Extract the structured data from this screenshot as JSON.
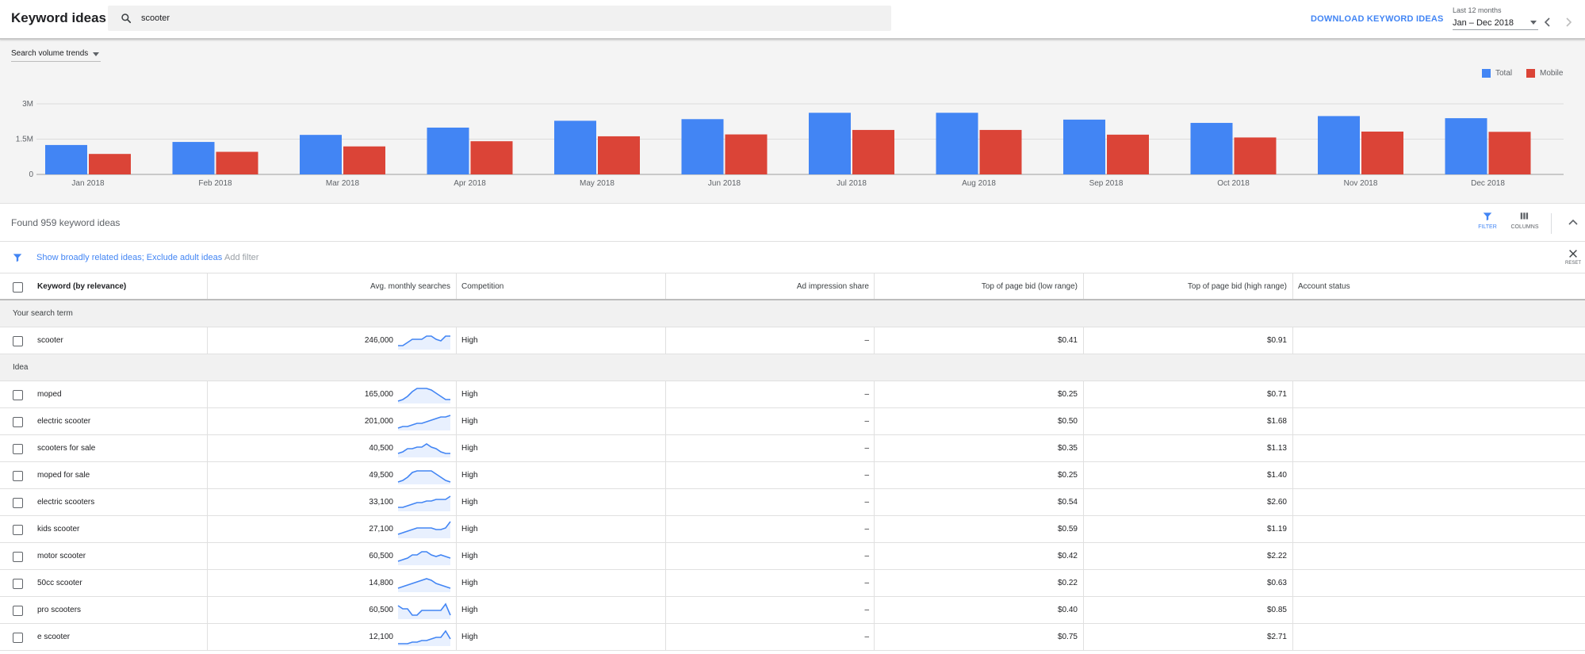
{
  "header": {
    "title": "Keyword ideas",
    "search_value": "scooter",
    "download_label": "DOWNLOAD KEYWORD IDEAS",
    "range_label": "Last 12 months",
    "range_value": "Jan – Dec 2018"
  },
  "chart_panel": {
    "trend_select": "Search volume trends",
    "legend": [
      {
        "name": "Total",
        "color": "#4285f4"
      },
      {
        "name": "Mobile",
        "color": "#db4437"
      }
    ]
  },
  "chart_data": {
    "type": "bar",
    "title": "",
    "categories": [
      "Jan 2018",
      "Feb 2018",
      "Mar 2018",
      "Apr 2018",
      "May 2018",
      "Jun 2018",
      "Jul 2018",
      "Aug 2018",
      "Sep 2018",
      "Oct 2018",
      "Nov 2018",
      "Dec 2018"
    ],
    "series": [
      {
        "name": "Total",
        "color": "#4285f4",
        "values": [
          1250000,
          1380000,
          1680000,
          1990000,
          2280000,
          2350000,
          2620000,
          2620000,
          2330000,
          2190000,
          2480000,
          2390000
        ]
      },
      {
        "name": "Mobile",
        "color": "#db4437",
        "values": [
          870000,
          960000,
          1190000,
          1410000,
          1620000,
          1700000,
          1890000,
          1890000,
          1690000,
          1570000,
          1820000,
          1810000
        ]
      }
    ],
    "yticks": [
      "0",
      "1.5M",
      "3M"
    ],
    "ylim": [
      0,
      3000000
    ],
    "grid": true,
    "legend_position": "top-right"
  },
  "summary": {
    "found_text": "Found 959 keyword ideas",
    "filter_label": "FILTER",
    "columns_label": "COLUMNS"
  },
  "filterbar": {
    "active_filter": "Show broadly related ideas; Exclude adult ideas",
    "add_filter": "Add filter",
    "reset_label": "RESET"
  },
  "table": {
    "headers": {
      "keyword": "Keyword (by relevance)",
      "searches": "Avg. monthly searches",
      "competition": "Competition",
      "impression": "Ad impression share",
      "bid_low": "Top of page bid (low range)",
      "bid_high": "Top of page bid (high range)",
      "status": "Account status"
    },
    "group_search": "Your search term",
    "group_idea": "Idea",
    "search_rows": [
      {
        "keyword": "scooter",
        "searches": "246,000",
        "competition": "High",
        "impression": "–",
        "bid_low": "$0.41",
        "bid_high": "$0.91",
        "trend": [
          2,
          2,
          4,
          6,
          6,
          6,
          8,
          8,
          6,
          5,
          8,
          8
        ]
      }
    ],
    "idea_rows": [
      {
        "keyword": "moped",
        "searches": "165,000",
        "competition": "High",
        "impression": "–",
        "bid_low": "$0.25",
        "bid_high": "$0.71",
        "trend": [
          1,
          2,
          4,
          7,
          9,
          9,
          9,
          8,
          6,
          4,
          2,
          2
        ]
      },
      {
        "keyword": "electric scooter",
        "searches": "201,000",
        "competition": "High",
        "impression": "–",
        "bid_low": "$0.50",
        "bid_high": "$1.68",
        "trend": [
          1,
          2,
          2,
          3,
          4,
          4,
          5,
          6,
          7,
          8,
          8,
          9
        ]
      },
      {
        "keyword": "scooters for sale",
        "searches": "40,500",
        "competition": "High",
        "impression": "–",
        "bid_low": "$0.35",
        "bid_high": "$1.13",
        "trend": [
          2,
          3,
          5,
          5,
          6,
          6,
          8,
          6,
          5,
          3,
          2,
          2
        ]
      },
      {
        "keyword": "moped for sale",
        "searches": "49,500",
        "competition": "High",
        "impression": "–",
        "bid_low": "$0.25",
        "bid_high": "$1.40",
        "trend": [
          1,
          2,
          4,
          7,
          8,
          8,
          8,
          8,
          6,
          4,
          2,
          1
        ]
      },
      {
        "keyword": "electric scooters",
        "searches": "33,100",
        "competition": "High",
        "impression": "–",
        "bid_low": "$0.54",
        "bid_high": "$2.60",
        "trend": [
          2,
          2,
          3,
          4,
          5,
          5,
          6,
          6,
          7,
          7,
          7,
          9
        ]
      },
      {
        "keyword": "kids scooter",
        "searches": "27,100",
        "competition": "High",
        "impression": "–",
        "bid_low": "$0.59",
        "bid_high": "$1.19",
        "trend": [
          2,
          3,
          4,
          5,
          6,
          6,
          6,
          6,
          5,
          5,
          6,
          10
        ]
      },
      {
        "keyword": "motor scooter",
        "searches": "60,500",
        "competition": "High",
        "impression": "–",
        "bid_low": "$0.42",
        "bid_high": "$2.22",
        "trend": [
          2,
          3,
          4,
          6,
          6,
          8,
          8,
          6,
          5,
          6,
          5,
          4
        ]
      },
      {
        "keyword": "50cc scooter",
        "searches": "14,800",
        "competition": "High",
        "impression": "–",
        "bid_low": "$0.22",
        "bid_high": "$0.63",
        "trend": [
          2,
          3,
          4,
          5,
          6,
          7,
          8,
          7,
          5,
          4,
          3,
          2
        ]
      },
      {
        "keyword": "pro scooters",
        "searches": "60,500",
        "competition": "High",
        "impression": "–",
        "bid_low": "$0.40",
        "bid_high": "$0.85",
        "trend": [
          8,
          6,
          6,
          2,
          2,
          5,
          5,
          5,
          5,
          5,
          9,
          2
        ]
      },
      {
        "keyword": "e scooter",
        "searches": "12,100",
        "competition": "High",
        "impression": "–",
        "bid_low": "$0.75",
        "bid_high": "$2.71",
        "trend": [
          1,
          1,
          1,
          2,
          2,
          3,
          3,
          4,
          5,
          5,
          9,
          4
        ]
      }
    ]
  }
}
